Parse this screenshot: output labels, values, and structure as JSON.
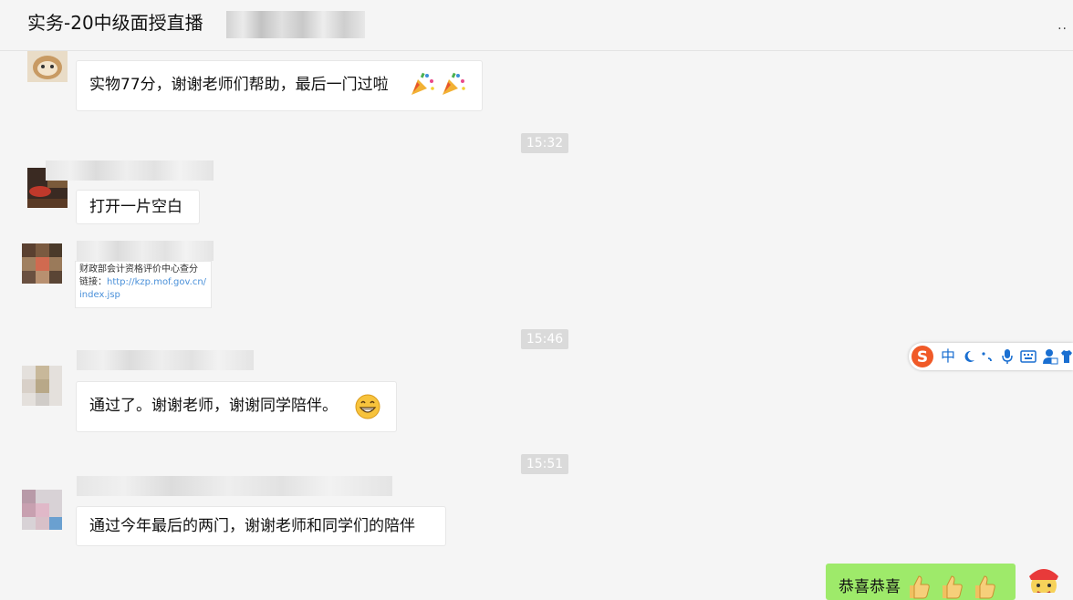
{
  "header": {
    "title": "实务-20中级面授直播",
    "more_label": "··"
  },
  "messages": [
    {
      "text": "实物77分，谢谢老师们帮助，最后一门过啦",
      "emojis": [
        "party-popper",
        "party-popper"
      ]
    },
    {
      "time": "15:32"
    },
    {
      "text": "打开一片空白"
    },
    {
      "card": {
        "title": "财政部会计资格评价中心查分",
        "link_prefix": "链接：",
        "link_line1": "http://kzp.mof.gov.cn/",
        "link_line2": "index.jsp"
      }
    },
    {
      "time": "15:46"
    },
    {
      "text": "通过了。谢谢老师，谢谢同学陪伴。",
      "emojis": [
        "grin-face"
      ]
    },
    {
      "time": "15:51"
    },
    {
      "text": "通过今年最后的两门，谢谢老师和同学们的陪伴"
    },
    {
      "self_text": "恭喜恭喜",
      "emojis": [
        "thumbs-up",
        "thumbs-up",
        "thumbs-up"
      ]
    }
  ],
  "ime_toolbar": {
    "logo": "S",
    "mode": "中",
    "items": [
      "moon-icon",
      "punctuation-icon",
      "microphone-icon",
      "keyboard-icon",
      "user-icon",
      "shirt-icon"
    ]
  },
  "colors": {
    "background": "#f5f5f5",
    "bubble": "#ffffff",
    "self_bubble": "#9eea6a",
    "timestamp": "#dadada",
    "ime_accent": "#1a6fd1",
    "ime_logo": "#f05a28"
  }
}
